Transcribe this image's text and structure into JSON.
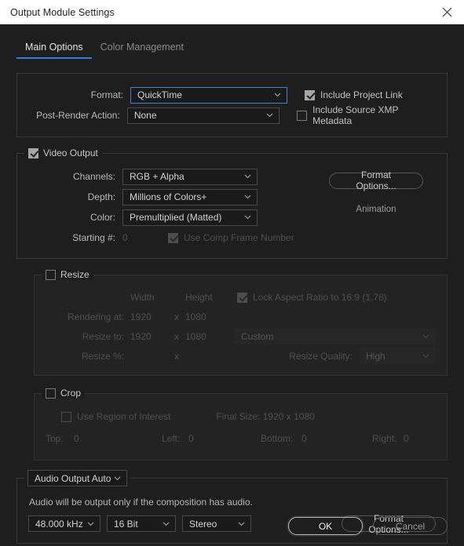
{
  "window": {
    "title": "Output Module Settings",
    "close_icon": "close-icon"
  },
  "tabs": [
    {
      "label": "Main Options",
      "active": true
    },
    {
      "label": "Color Management",
      "active": false
    }
  ],
  "main_options": {
    "format_label": "Format:",
    "format_value": "QuickTime",
    "post_render_label": "Post-Render Action:",
    "post_render_value": "None",
    "include_project_link_label": "Include Project Link",
    "include_project_link_checked": true,
    "include_xmp_label": "Include Source XMP Metadata",
    "include_xmp_checked": false
  },
  "video_output": {
    "title": "Video Output",
    "checked": true,
    "channels_label": "Channels:",
    "channels_value": "RGB + Alpha",
    "depth_label": "Depth:",
    "depth_value": "Millions of Colors+",
    "color_label": "Color:",
    "color_value": "Premultiplied (Matted)",
    "starting_label": "Starting #:",
    "starting_value": "0",
    "use_comp_frame_label": "Use Comp Frame Number",
    "use_comp_frame_checked": true,
    "format_options_label": "Format Options...",
    "codec_name": "Animation"
  },
  "resize": {
    "title": "Resize",
    "checked": false,
    "width_header": "Width",
    "height_header": "Height",
    "lock_aspect_label": "Lock Aspect Ratio to 16:9 (1.78)",
    "lock_aspect_checked": true,
    "rendering_at_label": "Rendering at:",
    "rendering_width": "1920",
    "rendering_height": "1080",
    "resize_to_label": "Resize to:",
    "resize_width": "1920",
    "resize_height": "1080",
    "preset_value": "Custom",
    "resize_pct_label": "Resize %:",
    "resize_pct_width": "",
    "resize_pct_height": "",
    "times_symbol": "x",
    "quality_label": "Resize Quality:",
    "quality_value": "High"
  },
  "crop": {
    "title": "Crop",
    "checked": false,
    "use_roi_label": "Use Region of Interest",
    "use_roi_checked": false,
    "final_size_label": "Final Size: 1920 x 1080",
    "top_label": "Top:",
    "top_value": "0",
    "left_label": "Left:",
    "left_value": "0",
    "bottom_label": "Bottom:",
    "bottom_value": "0",
    "right_label": "Right:",
    "right_value": "0"
  },
  "audio": {
    "mode_value": "Audio Output Auto",
    "note": "Audio will be output only if the composition has audio.",
    "sample_rate": "48.000 kHz",
    "bit_depth": "16 Bit",
    "channels": "Stereo",
    "format_options_label": "Format Options..."
  },
  "footer": {
    "ok_label": "OK",
    "cancel_label": "Cancel"
  },
  "colors": {
    "accent": "#2f7fd4",
    "focus_border": "#3a86d4",
    "titlebar_bg": "#ffffff",
    "dialog_bg": "#1e1e1e",
    "panel_bg": "#232323"
  }
}
